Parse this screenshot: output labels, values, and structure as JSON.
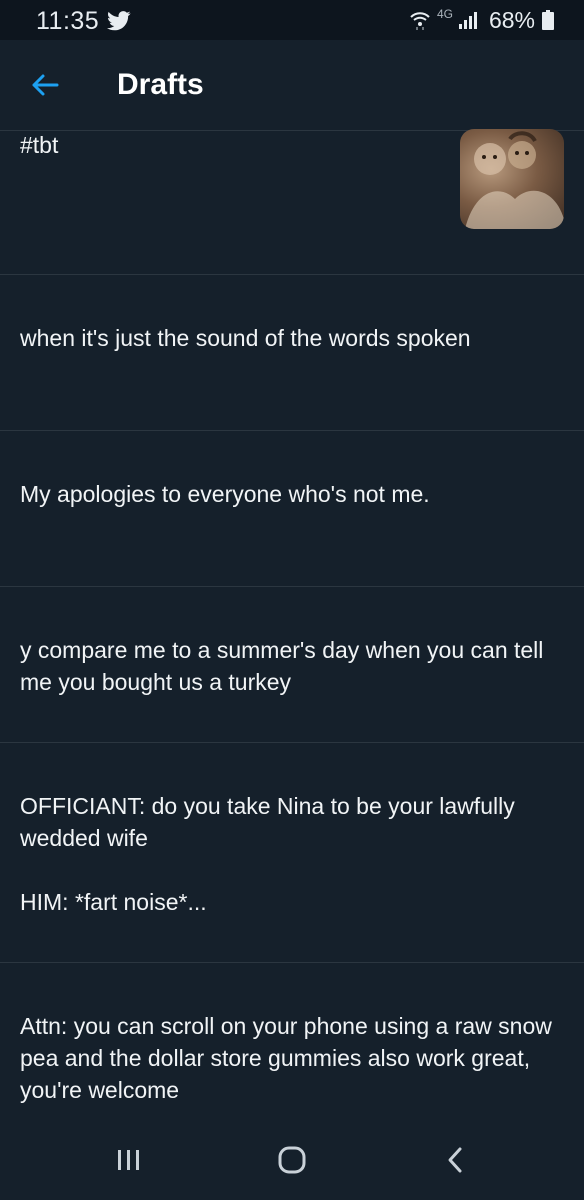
{
  "status_bar": {
    "time": "11:35",
    "network": "4G",
    "battery": "68%"
  },
  "header": {
    "title": "Drafts"
  },
  "drafts": [
    {
      "text": "#tbt",
      "has_image": true
    },
    {
      "text": "when it's just the sound of the words spoken"
    },
    {
      "text": "My apologies to everyone who's not me."
    },
    {
      "text": "y compare me to a summer's day when you can tell me you bought us a turkey"
    },
    {
      "text": "OFFICIANT: do you take Nina to be your lawfully wedded wife\n\nHIM: *fart noise*..."
    },
    {
      "text": "Attn: you can scroll on your phone using a raw snow pea and the dollar store gummies also work great, you're welcome"
    }
  ],
  "icons": {
    "back": "back-arrow-icon",
    "nav_recents": "recent-apps-icon",
    "nav_home": "home-icon",
    "nav_back": "back-chevron-icon"
  },
  "colors": {
    "background": "#15202b",
    "accent": "#1da1f2",
    "divider": "#2b3640"
  }
}
